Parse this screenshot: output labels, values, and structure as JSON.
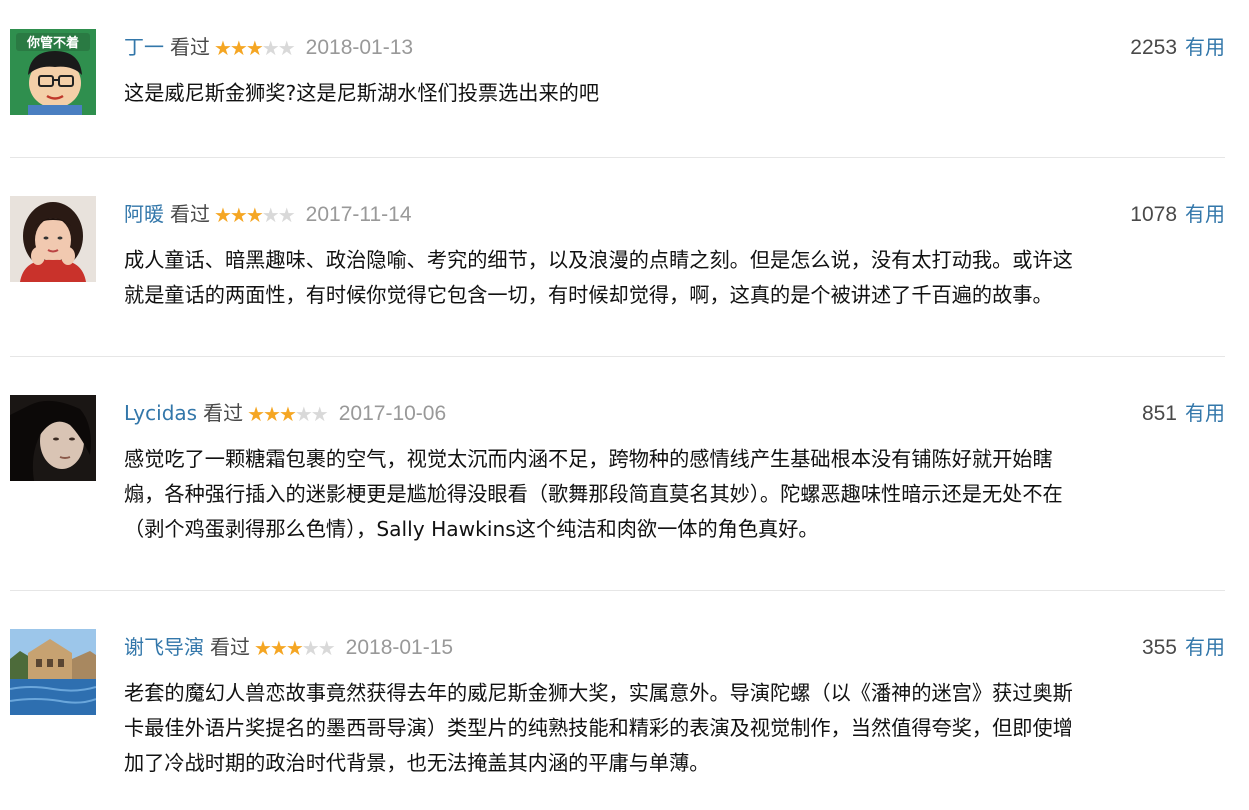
{
  "comments": [
    {
      "username": "丁一",
      "status": "看过",
      "rating": 3,
      "rating_max": 5,
      "date": "2018-01-13",
      "votes": "2253",
      "useful_label": "有用",
      "avatar_text": "你管不着",
      "text": "这是威尼斯金狮奖?这是尼斯湖水怪们投票选出来的吧"
    },
    {
      "username": "阿暖",
      "status": "看过",
      "rating": 3,
      "rating_max": 5,
      "date": "2017-11-14",
      "votes": "1078",
      "useful_label": "有用",
      "text": "成人童话、暗黑趣味、政治隐喻、考究的细节，以及浪漫的点睛之刻。但是怎么说，没有太打动我。或许这\n就是童话的两面性，有时候你觉得它包含一切，有时候却觉得，啊，这真的是个被讲述了千百遍的故事。"
    },
    {
      "username": "Lycidas",
      "status": "看过",
      "rating": 3,
      "rating_max": 5,
      "date": "2017-10-06",
      "votes": "851",
      "useful_label": "有用",
      "text": "感觉吃了一颗糖霜包裹的空气，视觉太沉而内涵不足，跨物种的感情线产生基础根本没有铺陈好就开始瞎\n煽，各种强行插入的迷影梗更是尴尬得没眼看（歌舞那段简直莫名其妙）。陀螺恶趣味性暗示还是无处不在\n（剥个鸡蛋剥得那么色情），Sally Hawkins这个纯洁和肉欲一体的角色真好。"
    },
    {
      "username": "谢飞导演",
      "status": "看过",
      "rating": 3,
      "rating_max": 5,
      "date": "2018-01-15",
      "votes": "355",
      "useful_label": "有用",
      "text": "老套的魔幻人兽恋故事竟然获得去年的威尼斯金狮大奖，实属意外。导演陀螺（以《潘神的迷宫》获过奥斯\n卡最佳外语片奖提名的墨西哥导演）类型片的纯熟技能和精彩的表演及视觉制作，当然值得夸奖，但即使增\n加了冷战时期的政治时代背景，也无法掩盖其内涵的平庸与单薄。"
    }
  ],
  "colors": {
    "link": "#3377aa",
    "star_on": "#f5a623",
    "star_off": "#d9d9d9",
    "date": "#999999",
    "divider": "#e6e6e6"
  }
}
